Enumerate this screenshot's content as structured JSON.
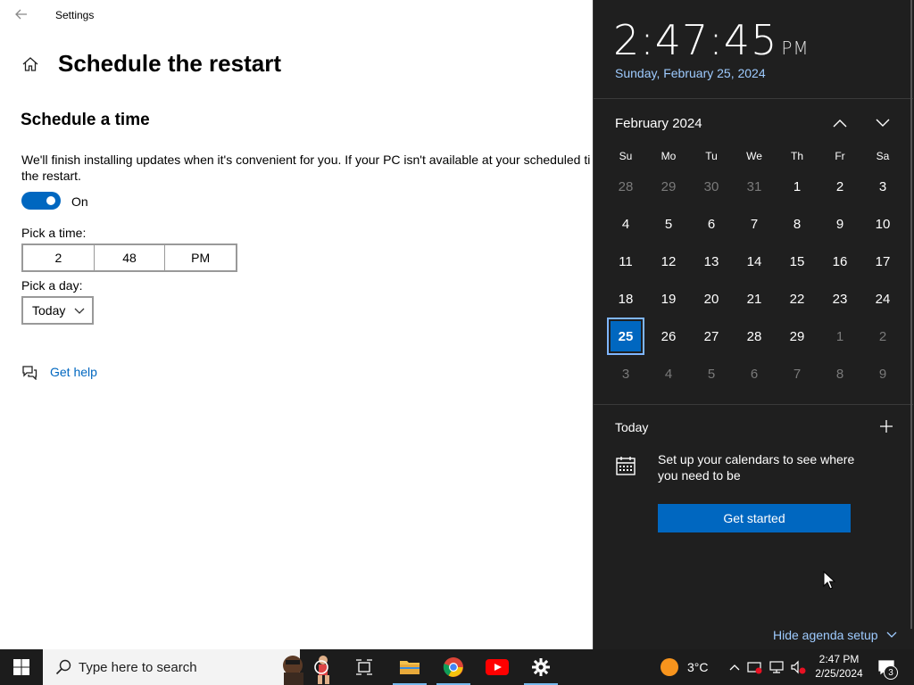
{
  "window": {
    "title": "Settings"
  },
  "page": {
    "title": "Schedule the restart",
    "section_title": "Schedule a time",
    "description": "We'll finish installing updates when it's convenient for you. If your PC isn't available at your scheduled time, we'll schedule the restart.",
    "description_line1": "We'll finish installing updates when it's convenient for you. If your PC isn't available at your scheduled ti",
    "description_line2": "the restart.",
    "toggle": {
      "label": "On",
      "state": "on"
    },
    "time_label": "Pick a time:",
    "time": {
      "hour": "2",
      "minute": "48",
      "period": "PM"
    },
    "day_label": "Pick a day:",
    "day_value": "Today",
    "help_link": "Get help"
  },
  "flyout": {
    "clock": {
      "time": "2:47:45",
      "period": "PM"
    },
    "long_date": "Sunday, February 25, 2024",
    "month_label": "February 2024",
    "weekdays": [
      "Su",
      "Mo",
      "Tu",
      "We",
      "Th",
      "Fr",
      "Sa"
    ],
    "days": [
      [
        "28",
        "29",
        "30",
        "31",
        "1",
        "2",
        "3"
      ],
      [
        "4",
        "5",
        "6",
        "7",
        "8",
        "9",
        "10"
      ],
      [
        "11",
        "12",
        "13",
        "14",
        "15",
        "16",
        "17"
      ],
      [
        "18",
        "19",
        "20",
        "21",
        "22",
        "23",
        "24"
      ],
      [
        "25",
        "26",
        "27",
        "28",
        "29",
        "1",
        "2"
      ],
      [
        "3",
        "4",
        "5",
        "6",
        "7",
        "8",
        "9"
      ]
    ],
    "today_label": "Today",
    "agenda_text": "Set up your calendars to see where you need to be",
    "get_started": "Get started",
    "hide_agenda": "Hide agenda setup"
  },
  "taskbar": {
    "search_placeholder": "Type here to search",
    "weather": "3°C",
    "time": "2:47 PM",
    "date": "2/25/2024",
    "notification_count": "3"
  },
  "colors": {
    "accent": "#0067c0",
    "flyout_bg": "#1f1f1f",
    "taskbar_bg": "#1c1c1c",
    "link_light": "#9ecbff"
  }
}
